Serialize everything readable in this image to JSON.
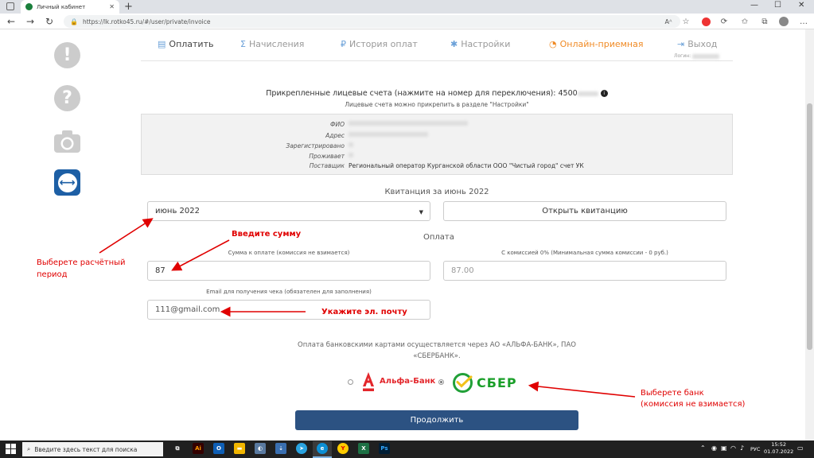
{
  "browser": {
    "tab_title": "Личный кабинет",
    "url": "https://lk.rotko45.ru/#/user/private/invoice",
    "reader_icon": "Aᴬ"
  },
  "menu": {
    "items": [
      {
        "label": "Оплатить",
        "icon": "document-icon"
      },
      {
        "label": "Начисления",
        "icon": "sigma-icon"
      },
      {
        "label": "История оплат",
        "icon": "ruble-icon"
      },
      {
        "label": "Настройки",
        "icon": "snowflake-icon"
      },
      {
        "label": "Онлайн-приемная",
        "icon": "chat-icon"
      },
      {
        "label": "Выход",
        "icon": "logout-icon"
      }
    ],
    "login_label": "Логин:"
  },
  "accounts": {
    "line": "Прикрепленные лицевые счета (нажмите на номер для переключения): 4500",
    "hint": "Лицевые счета можно прикрепить в разделе \"Настройки\""
  },
  "info": {
    "rows": [
      {
        "label": "ФИО"
      },
      {
        "label": "Адрес"
      },
      {
        "label": "Зарегистрировано"
      },
      {
        "label": "Проживает"
      },
      {
        "label": "Поставщик",
        "value": "Региональный оператор Курганской области ООО \"Чистый город\" счет УК"
      }
    ]
  },
  "invoice": {
    "title": "Квитанция за июнь 2022",
    "period_value": "июнь 2022",
    "open_button": "Открыть квитанцию"
  },
  "payment": {
    "title": "Оплата",
    "amount_label": "Сумма к оплате (комиссия не взимается)",
    "amount_value": "87",
    "commission_label": "С комиссией 0% (Минимальная сумма комиссии - 0 руб.)",
    "commission_value": "87.00",
    "email_label": "Email для получения чека (обязателен для заполнения)",
    "email_value": "111@gmail.com",
    "note_line1": "Оплата банковскими картами осуществляется через АО «АЛЬФА-БАНК», ПАО",
    "note_line2": "«СБЕРБАНК».",
    "bank_alfa": "Альфа-Банк",
    "bank_sber": "СБЕР",
    "selected_bank": "СБЕР",
    "continue_button": "Продолжить"
  },
  "annotations": {
    "enter_amount": "Введите сумму",
    "choose_period_1": "Выберете расчётный",
    "choose_period_2": "период",
    "enter_email": "Укажите эл. почту",
    "choose_bank_1": "Выберете банк",
    "choose_bank_2": "(комиссия не взимается)"
  },
  "taskbar": {
    "search_placeholder": "Введите здесь текст для поиска",
    "lang": "РУС",
    "time": "15:52",
    "date": "01.07.2022"
  },
  "colors": {
    "accent_orange": "#f08a24",
    "button_blue": "#2c5282",
    "annotation_red": "#e00000",
    "sber_green": "#1a9f29",
    "alfa_red": "#e3262b"
  }
}
